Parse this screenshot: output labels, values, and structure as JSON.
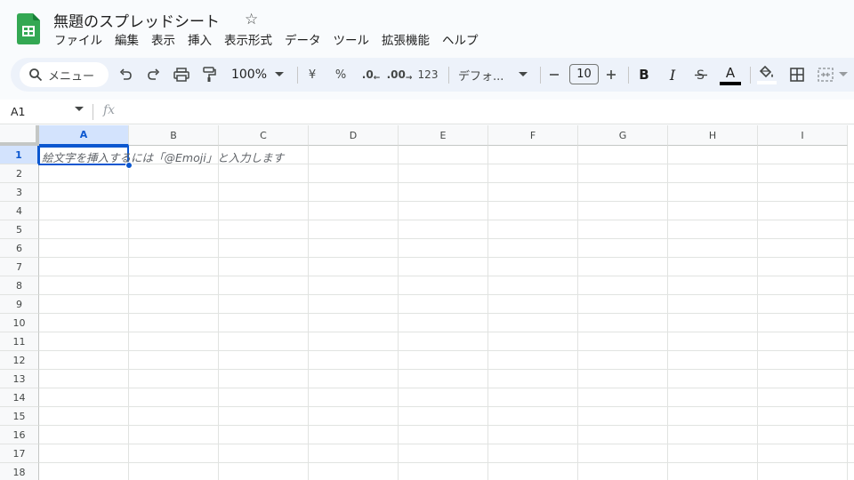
{
  "header": {
    "title": "無題のスプレッドシート",
    "menu": [
      "ファイル",
      "編集",
      "表示",
      "挿入",
      "表示形式",
      "データ",
      "ツール",
      "拡張機能",
      "ヘルプ"
    ]
  },
  "toolbar": {
    "search_label": "メニュー",
    "zoom": "100%",
    "currency": "¥",
    "percent": "%",
    "decrease_decimal": ".0",
    "increase_decimal": ".00",
    "number_format": "123",
    "font": "デフォ...",
    "font_size": "10",
    "bold": "B",
    "italic": "I",
    "text_color_glyph": "A",
    "accent_color": "#0b57d0"
  },
  "formula_bar": {
    "cell_ref": "A1",
    "fx": "fx"
  },
  "grid": {
    "columns": [
      "A",
      "B",
      "C",
      "D",
      "E",
      "F",
      "G",
      "H",
      "I"
    ],
    "rows": [
      "1",
      "2",
      "3",
      "4",
      "5",
      "6",
      "7",
      "8",
      "9",
      "10",
      "11",
      "12",
      "13",
      "14",
      "15",
      "16",
      "17",
      "18"
    ],
    "selected_column": "A",
    "selected_row": "1",
    "placeholder": "絵文字を挿入するには「@Emoji」と入力します"
  }
}
